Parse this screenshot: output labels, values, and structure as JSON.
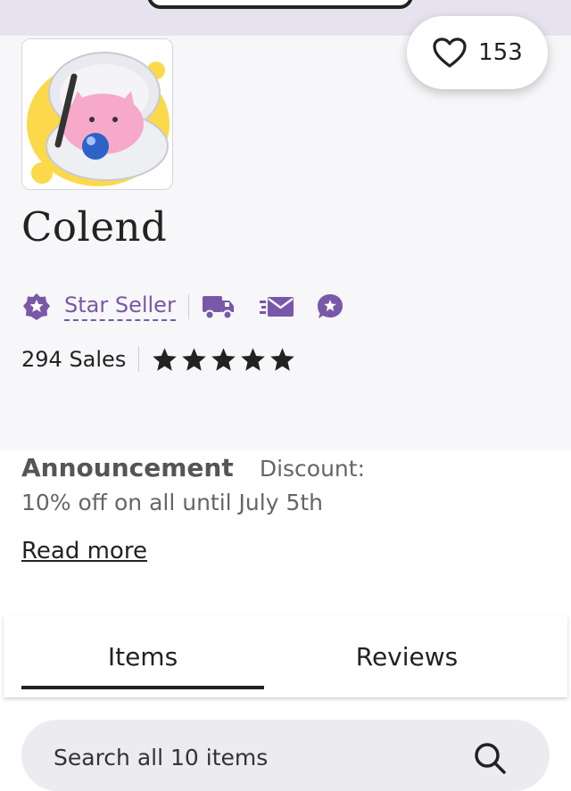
{
  "shop": {
    "name": "Colend",
    "favorites_count": "153",
    "star_seller_label": "Star Seller",
    "sales": "294 Sales",
    "rating_stars": 5
  },
  "announcement": {
    "title": "Announcement",
    "line1": "Discount:",
    "line2": "10% off on all until July 5th",
    "read_more": "Read more"
  },
  "tabs": [
    {
      "label": "Items",
      "active": true
    },
    {
      "label": "Reviews",
      "active": false
    }
  ],
  "search": {
    "placeholder": "Search all 10 items"
  },
  "colors": {
    "accent": "#7a58a8",
    "header_bg": "#f7f6f9",
    "text": "#222222"
  },
  "icons": [
    "heart-icon",
    "star-seller-icon",
    "truck-icon",
    "fast-mail-icon",
    "star-message-icon",
    "star-icon",
    "search-icon"
  ]
}
